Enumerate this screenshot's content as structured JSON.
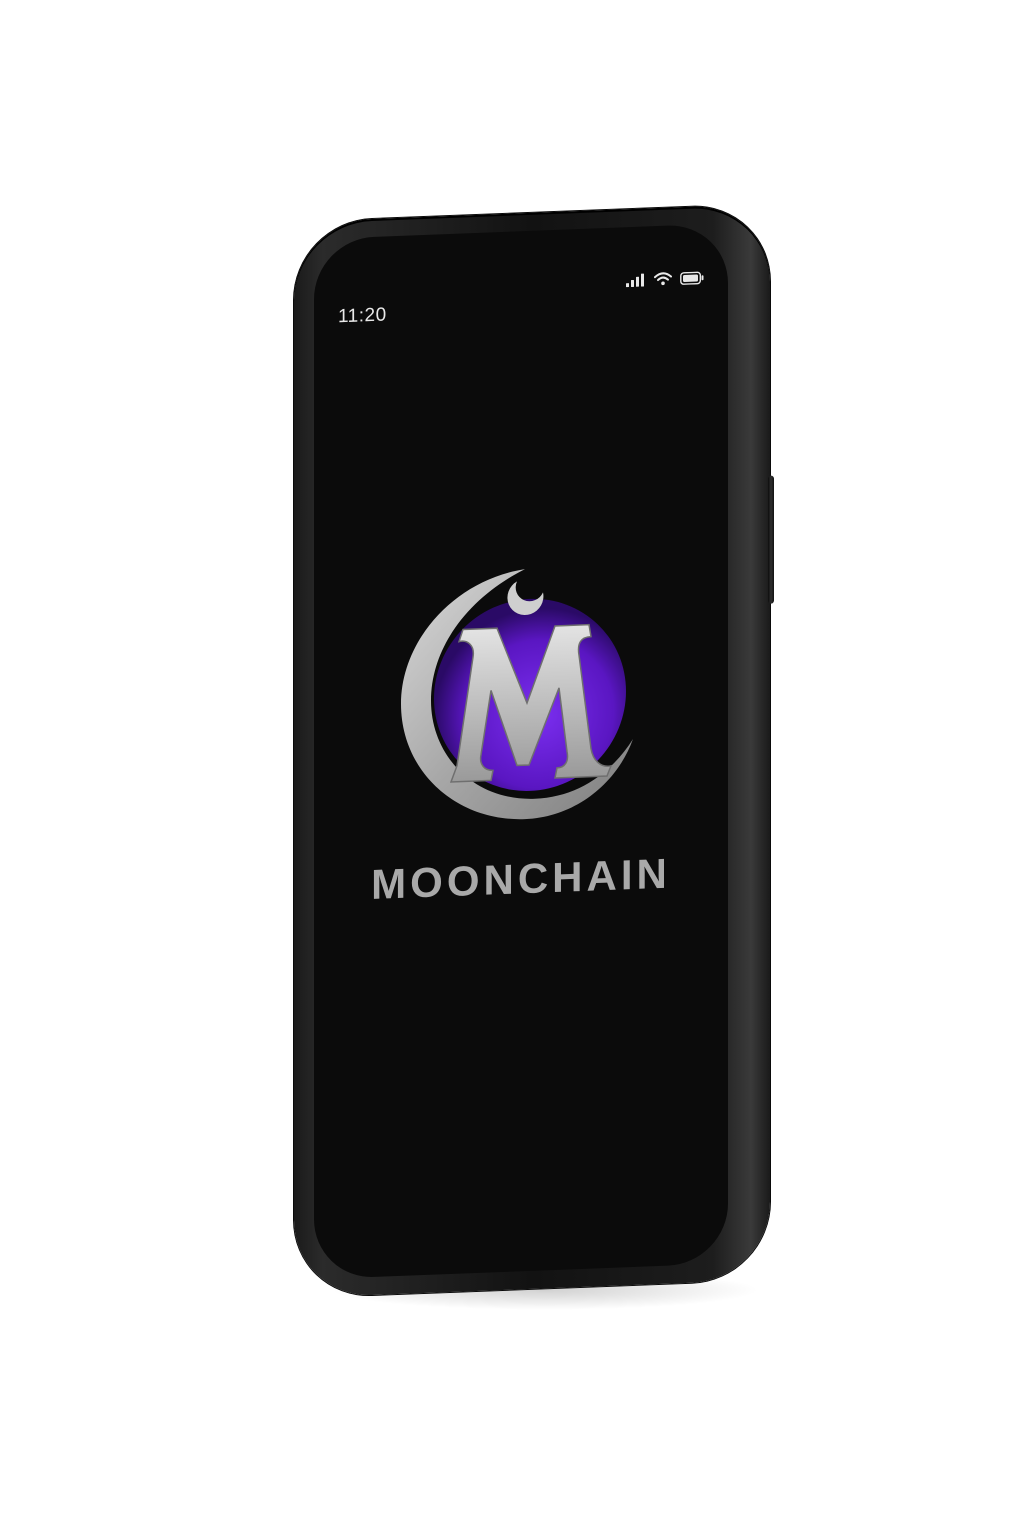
{
  "status_bar": {
    "time": "11:20",
    "icons": [
      "cellular-signal-icon",
      "wifi-icon",
      "battery-icon"
    ]
  },
  "app": {
    "logo": "moonchain-crescent-m-logo",
    "brand_name": "MOONCHAIN"
  },
  "colors": {
    "screen_background": "#0b0b0b",
    "logo_purple": "#6a1fd1",
    "logo_silver": "#b3b3b3",
    "brand_text": "#a9a9a9"
  }
}
